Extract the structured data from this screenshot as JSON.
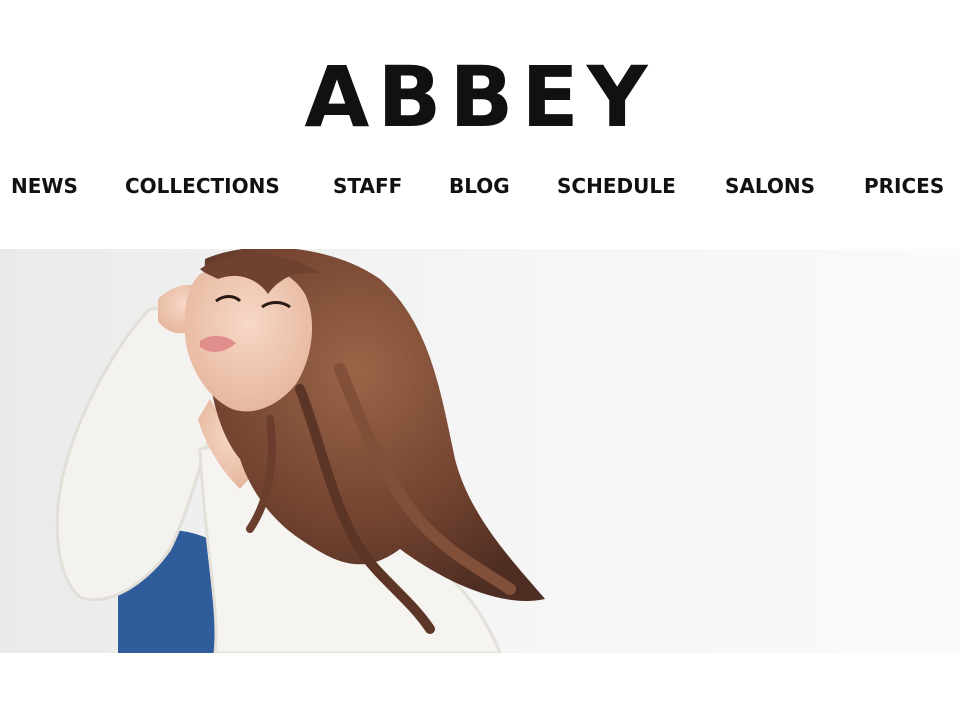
{
  "header": {
    "logo_text": "ABBEY"
  },
  "nav": {
    "items": [
      {
        "label": "NEWS"
      },
      {
        "label": "COLLECTIONS"
      },
      {
        "label": "STAFF"
      },
      {
        "label": "BLOG"
      },
      {
        "label": "SCHEDULE"
      },
      {
        "label": "SALONS"
      },
      {
        "label": "PRICES"
      }
    ]
  },
  "hero": {
    "image_subject": "model-portrait-photo",
    "colors": {
      "backdrop": "#f3f4f3",
      "hair": "#7a4b36",
      "sweater": "#f4f2ee",
      "denim": "#2f5c9a",
      "skin": "#f0cbb6"
    }
  }
}
